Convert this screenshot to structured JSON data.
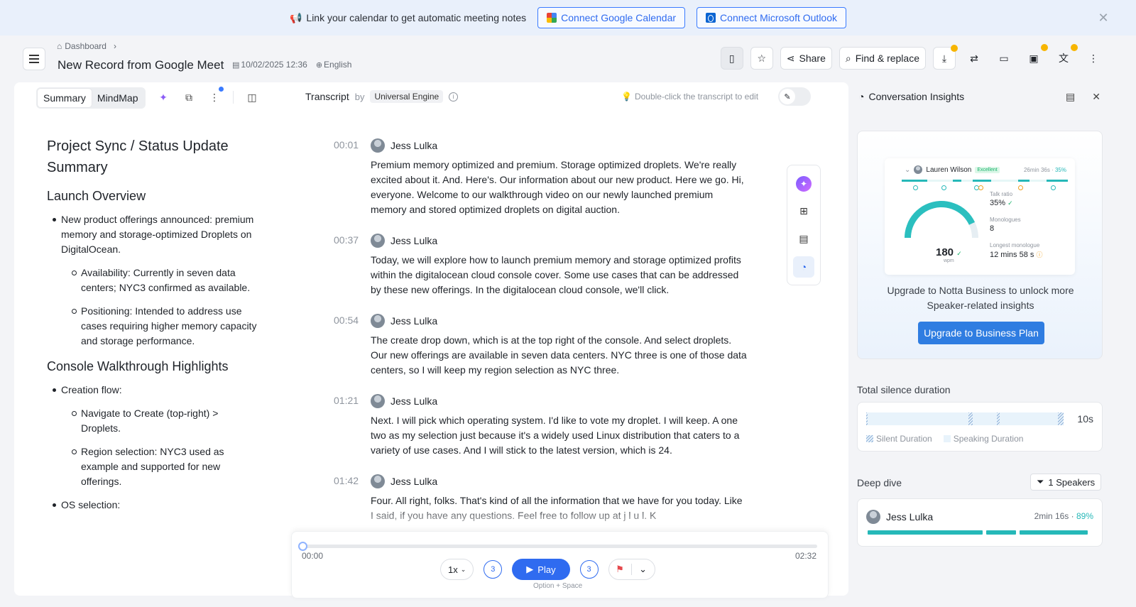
{
  "banner": {
    "message": "Link your calendar to get automatic meeting notes",
    "google_btn": "Connect Google Calendar",
    "outlook_btn": "Connect Microsoft Outlook"
  },
  "header": {
    "breadcrumb": "Dashboard",
    "title": "New Record from Google Meet",
    "date": "10/02/2025 12:36",
    "language": "English",
    "share": "Share",
    "find_replace": "Find & replace"
  },
  "summary_panel": {
    "tabs": [
      "Summary",
      "MindMap"
    ],
    "heading": "Project Sync / Status Update Summary",
    "sections": [
      {
        "title": "Launch Overview",
        "bullet": "New product offerings announced: premium memory and storage-optimized Droplets on DigitalOcean.",
        "subs": [
          "Availability: Currently in seven data centers; NYC3 confirmed as available.",
          "Positioning: Intended to address use cases requiring higher memory capacity and storage performance."
        ]
      },
      {
        "title": "Console Walkthrough Highlights",
        "bullet": "Creation flow:",
        "subs": [
          "Navigate to Create (top-right) > Droplets.",
          "Region selection: NYC3 used as example and supported for new offerings."
        ],
        "bullet2": "OS selection:"
      }
    ]
  },
  "transcript": {
    "label": "Transcript",
    "by": "by",
    "engine": "Universal Engine",
    "hint": "Double-click the transcript to edit",
    "segments": [
      {
        "time": "00:01",
        "speaker": "Jess Lulka",
        "text": "Premium memory optimized and premium. Storage optimized droplets. We're really excited about it. And. Here's. Our information about our new product. Here we go. Hi, everyone. Welcome to our walkthrough video on our newly launched premium memory and stored optimized droplets on digital auction."
      },
      {
        "time": "00:37",
        "speaker": "Jess Lulka",
        "text": "Today, we will explore how to launch premium memory and storage optimized profits within the digitalocean cloud console cover. Some use cases that can be addressed by these new offerings. In the digitalocean cloud console, we'll click."
      },
      {
        "time": "00:54",
        "speaker": "Jess Lulka",
        "text": "The create drop down, which is at the top right of the console. And select droplets. Our new offerings are available in seven data centers. NYC three is one of those data centers, so I will keep my region selection as NYC three."
      },
      {
        "time": "01:21",
        "speaker": "Jess Lulka",
        "text": "Next. I will pick which operating system. I'd like to vote my droplet. I will keep. A one two as my selection just because it's a widely used Linux distribution that caters to a variety of use cases. And I will stick to the latest version, which is 24."
      },
      {
        "time": "01:42",
        "speaker": "Jess Lulka",
        "text": "Four. All right, folks. That's kind of all the information that we have for you today. Like I said, if you have any questions. Feel free to follow up at j l u l. K a@digitalocean.com. As well as just a reminder for myself, for anyone that's joining"
      }
    ]
  },
  "player": {
    "current": "00:00",
    "total": "02:32",
    "progress": 0,
    "speed": "1x",
    "skip_back": "3",
    "skip_fwd": "3",
    "play": "Play",
    "shortcut": "Option + Space"
  },
  "insights": {
    "title": "Conversation Insights",
    "mock": {
      "name": "Lauren Wilson",
      "rating": "Excellent",
      "time": "26min 36s",
      "pct": "35%",
      "wpm_value": "180",
      "wpm_label": "wpm",
      "talk_ratio_label": "Talk ratio",
      "talk_ratio": "35%",
      "monologues_label": "Monologues",
      "monologues": "8",
      "longest_label": "Longest monologue",
      "longest": "12 mins 58 s"
    },
    "upgrade_text": "Upgrade to Notta Business to unlock more Speaker-related insights",
    "upgrade_btn": "Upgrade to Business Plan",
    "silence_title": "Total silence duration",
    "silence_value": "10s",
    "legend_silent": "Silent Duration",
    "legend_speaking": "Speaking Duration",
    "deep_dive": "Deep dive",
    "speakers_filter": "1 Speakers",
    "speaker": {
      "name": "Jess Lulka",
      "duration": "2min 16s",
      "pct": "89%"
    }
  }
}
